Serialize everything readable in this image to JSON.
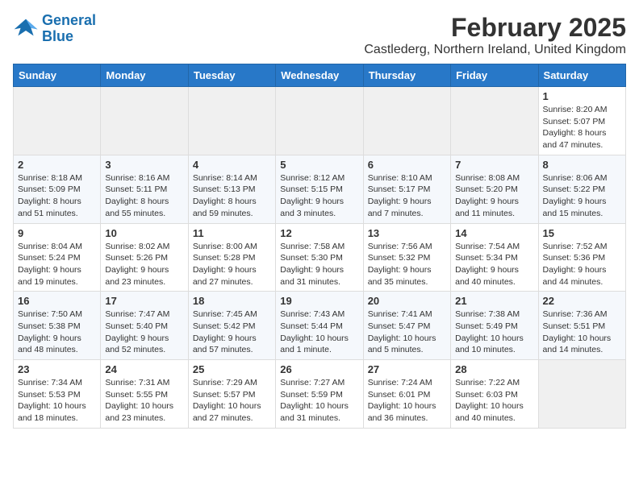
{
  "logo": {
    "line1": "General",
    "line2": "Blue"
  },
  "title": "February 2025",
  "location": "Castlederg, Northern Ireland, United Kingdom",
  "days_of_week": [
    "Sunday",
    "Monday",
    "Tuesday",
    "Wednesday",
    "Thursday",
    "Friday",
    "Saturday"
  ],
  "weeks": [
    [
      {
        "day": "",
        "info": ""
      },
      {
        "day": "",
        "info": ""
      },
      {
        "day": "",
        "info": ""
      },
      {
        "day": "",
        "info": ""
      },
      {
        "day": "",
        "info": ""
      },
      {
        "day": "",
        "info": ""
      },
      {
        "day": "1",
        "info": "Sunrise: 8:20 AM\nSunset: 5:07 PM\nDaylight: 8 hours and 47 minutes."
      }
    ],
    [
      {
        "day": "2",
        "info": "Sunrise: 8:18 AM\nSunset: 5:09 PM\nDaylight: 8 hours and 51 minutes."
      },
      {
        "day": "3",
        "info": "Sunrise: 8:16 AM\nSunset: 5:11 PM\nDaylight: 8 hours and 55 minutes."
      },
      {
        "day": "4",
        "info": "Sunrise: 8:14 AM\nSunset: 5:13 PM\nDaylight: 8 hours and 59 minutes."
      },
      {
        "day": "5",
        "info": "Sunrise: 8:12 AM\nSunset: 5:15 PM\nDaylight: 9 hours and 3 minutes."
      },
      {
        "day": "6",
        "info": "Sunrise: 8:10 AM\nSunset: 5:17 PM\nDaylight: 9 hours and 7 minutes."
      },
      {
        "day": "7",
        "info": "Sunrise: 8:08 AM\nSunset: 5:20 PM\nDaylight: 9 hours and 11 minutes."
      },
      {
        "day": "8",
        "info": "Sunrise: 8:06 AM\nSunset: 5:22 PM\nDaylight: 9 hours and 15 minutes."
      }
    ],
    [
      {
        "day": "9",
        "info": "Sunrise: 8:04 AM\nSunset: 5:24 PM\nDaylight: 9 hours and 19 minutes."
      },
      {
        "day": "10",
        "info": "Sunrise: 8:02 AM\nSunset: 5:26 PM\nDaylight: 9 hours and 23 minutes."
      },
      {
        "day": "11",
        "info": "Sunrise: 8:00 AM\nSunset: 5:28 PM\nDaylight: 9 hours and 27 minutes."
      },
      {
        "day": "12",
        "info": "Sunrise: 7:58 AM\nSunset: 5:30 PM\nDaylight: 9 hours and 31 minutes."
      },
      {
        "day": "13",
        "info": "Sunrise: 7:56 AM\nSunset: 5:32 PM\nDaylight: 9 hours and 35 minutes."
      },
      {
        "day": "14",
        "info": "Sunrise: 7:54 AM\nSunset: 5:34 PM\nDaylight: 9 hours and 40 minutes."
      },
      {
        "day": "15",
        "info": "Sunrise: 7:52 AM\nSunset: 5:36 PM\nDaylight: 9 hours and 44 minutes."
      }
    ],
    [
      {
        "day": "16",
        "info": "Sunrise: 7:50 AM\nSunset: 5:38 PM\nDaylight: 9 hours and 48 minutes."
      },
      {
        "day": "17",
        "info": "Sunrise: 7:47 AM\nSunset: 5:40 PM\nDaylight: 9 hours and 52 minutes."
      },
      {
        "day": "18",
        "info": "Sunrise: 7:45 AM\nSunset: 5:42 PM\nDaylight: 9 hours and 57 minutes."
      },
      {
        "day": "19",
        "info": "Sunrise: 7:43 AM\nSunset: 5:44 PM\nDaylight: 10 hours and 1 minute."
      },
      {
        "day": "20",
        "info": "Sunrise: 7:41 AM\nSunset: 5:47 PM\nDaylight: 10 hours and 5 minutes."
      },
      {
        "day": "21",
        "info": "Sunrise: 7:38 AM\nSunset: 5:49 PM\nDaylight: 10 hours and 10 minutes."
      },
      {
        "day": "22",
        "info": "Sunrise: 7:36 AM\nSunset: 5:51 PM\nDaylight: 10 hours and 14 minutes."
      }
    ],
    [
      {
        "day": "23",
        "info": "Sunrise: 7:34 AM\nSunset: 5:53 PM\nDaylight: 10 hours and 18 minutes."
      },
      {
        "day": "24",
        "info": "Sunrise: 7:31 AM\nSunset: 5:55 PM\nDaylight: 10 hours and 23 minutes."
      },
      {
        "day": "25",
        "info": "Sunrise: 7:29 AM\nSunset: 5:57 PM\nDaylight: 10 hours and 27 minutes."
      },
      {
        "day": "26",
        "info": "Sunrise: 7:27 AM\nSunset: 5:59 PM\nDaylight: 10 hours and 31 minutes."
      },
      {
        "day": "27",
        "info": "Sunrise: 7:24 AM\nSunset: 6:01 PM\nDaylight: 10 hours and 36 minutes."
      },
      {
        "day": "28",
        "info": "Sunrise: 7:22 AM\nSunset: 6:03 PM\nDaylight: 10 hours and 40 minutes."
      },
      {
        "day": "",
        "info": ""
      }
    ]
  ]
}
